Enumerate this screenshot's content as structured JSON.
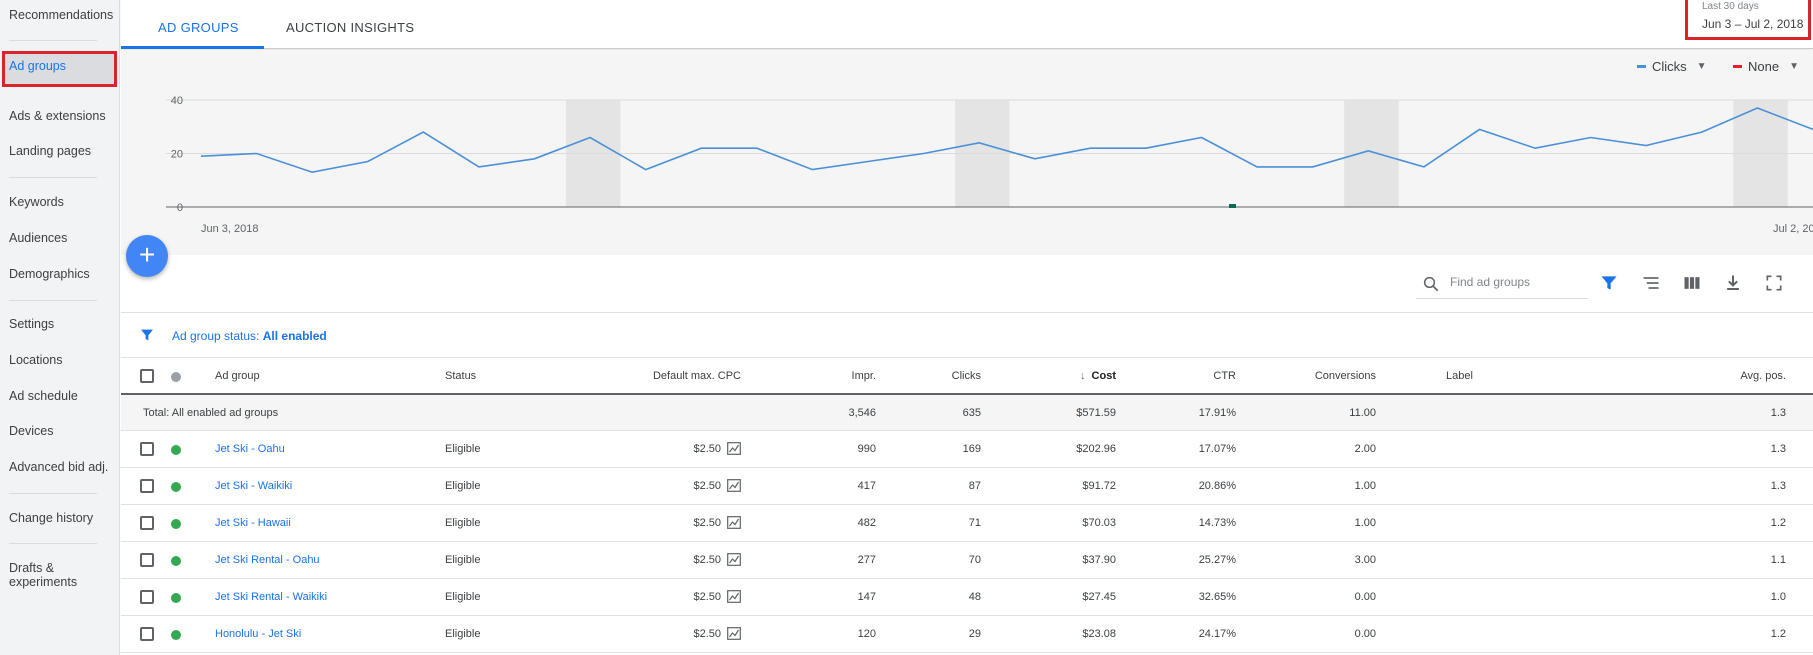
{
  "sidebar": {
    "items": [
      {
        "label": "Recommendations"
      },
      {
        "label": "Ad groups",
        "active": true
      },
      {
        "label": "Ads & extensions"
      },
      {
        "label": "Landing pages"
      },
      {
        "label": "Keywords"
      },
      {
        "label": "Audiences"
      },
      {
        "label": "Demographics"
      },
      {
        "label": "Settings"
      },
      {
        "label": "Locations"
      },
      {
        "label": "Ad schedule"
      },
      {
        "label": "Devices"
      },
      {
        "label": "Advanced bid adj."
      },
      {
        "label": "Change history"
      },
      {
        "label": "Drafts &"
      },
      {
        "label": "experiments"
      }
    ]
  },
  "tabs": [
    {
      "label": "AD GROUPS",
      "active": true
    },
    {
      "label": "AUCTION INSIGHTS"
    }
  ],
  "date": {
    "label": "Last 30 days",
    "range": "Jun 3 – Jul 2, 2018"
  },
  "chart_controls": {
    "metric1": {
      "label": "Clicks",
      "color": "#4a90d9"
    },
    "metric2": {
      "label": "None",
      "color": "#d9232d"
    }
  },
  "chart_data": {
    "type": "line",
    "series": [
      {
        "name": "Clicks",
        "values": [
          19,
          20,
          13,
          17,
          28,
          15,
          18,
          26,
          14,
          22,
          22,
          14,
          17,
          20,
          24,
          18,
          22,
          22,
          26,
          15,
          15,
          21,
          15,
          29,
          22,
          26,
          23,
          28,
          37,
          29
        ]
      }
    ],
    "y_ticks": [
      "0",
      "20",
      "40"
    ],
    "ylim": [
      0,
      40
    ],
    "x_start_label": "Jun 3, 2018",
    "x_end_label": "Jul 2, 20",
    "grid": true
  },
  "toolbar": {
    "search_placeholder": "Find ad groups",
    "fab_label": "+"
  },
  "filter": {
    "prefix": "Ad group status: ",
    "value": "All enabled"
  },
  "table": {
    "headers": {
      "ad_group": "Ad group",
      "status": "Status",
      "cpc": "Default max. CPC",
      "impr": "Impr.",
      "clicks": "Clicks",
      "cost": "Cost",
      "ctr": "CTR",
      "conv": "Conversions",
      "label": "Label",
      "avgpos": "Avg. pos."
    },
    "total": {
      "label": "Total: All enabled ad groups",
      "impr": "3,546",
      "clicks": "635",
      "cost": "$571.59",
      "ctr": "17.91%",
      "conv": "11.00",
      "avgpos": "1.3"
    },
    "rows": [
      {
        "name": "Jet Ski - Oahu",
        "status": "Eligible",
        "cpc": "$2.50",
        "impr": "990",
        "clicks": "169",
        "cost": "$202.96",
        "ctr": "17.07%",
        "conv": "2.00",
        "avgpos": "1.3"
      },
      {
        "name": "Jet Ski - Waikiki",
        "status": "Eligible",
        "cpc": "$2.50",
        "impr": "417",
        "clicks": "87",
        "cost": "$91.72",
        "ctr": "20.86%",
        "conv": "1.00",
        "avgpos": "1.3"
      },
      {
        "name": "Jet Ski - Hawaii",
        "status": "Eligible",
        "cpc": "$2.50",
        "impr": "482",
        "clicks": "71",
        "cost": "$70.03",
        "ctr": "14.73%",
        "conv": "1.00",
        "avgpos": "1.2"
      },
      {
        "name": "Jet Ski Rental - Oahu",
        "status": "Eligible",
        "cpc": "$2.50",
        "impr": "277",
        "clicks": "70",
        "cost": "$37.90",
        "ctr": "25.27%",
        "conv": "3.00",
        "avgpos": "1.1"
      },
      {
        "name": "Jet Ski Rental - Waikiki",
        "status": "Eligible",
        "cpc": "$2.50",
        "impr": "147",
        "clicks": "48",
        "cost": "$27.45",
        "ctr": "32.65%",
        "conv": "0.00",
        "avgpos": "1.0"
      },
      {
        "name": "Honolulu - Jet Ski",
        "status": "Eligible",
        "cpc": "$2.50",
        "impr": "120",
        "clicks": "29",
        "cost": "$23.08",
        "ctr": "24.17%",
        "conv": "0.00",
        "avgpos": "1.2"
      }
    ]
  },
  "colors": {
    "accent": "#1a73e8",
    "eligible": "#34a853",
    "highlight": "#d9232d"
  }
}
